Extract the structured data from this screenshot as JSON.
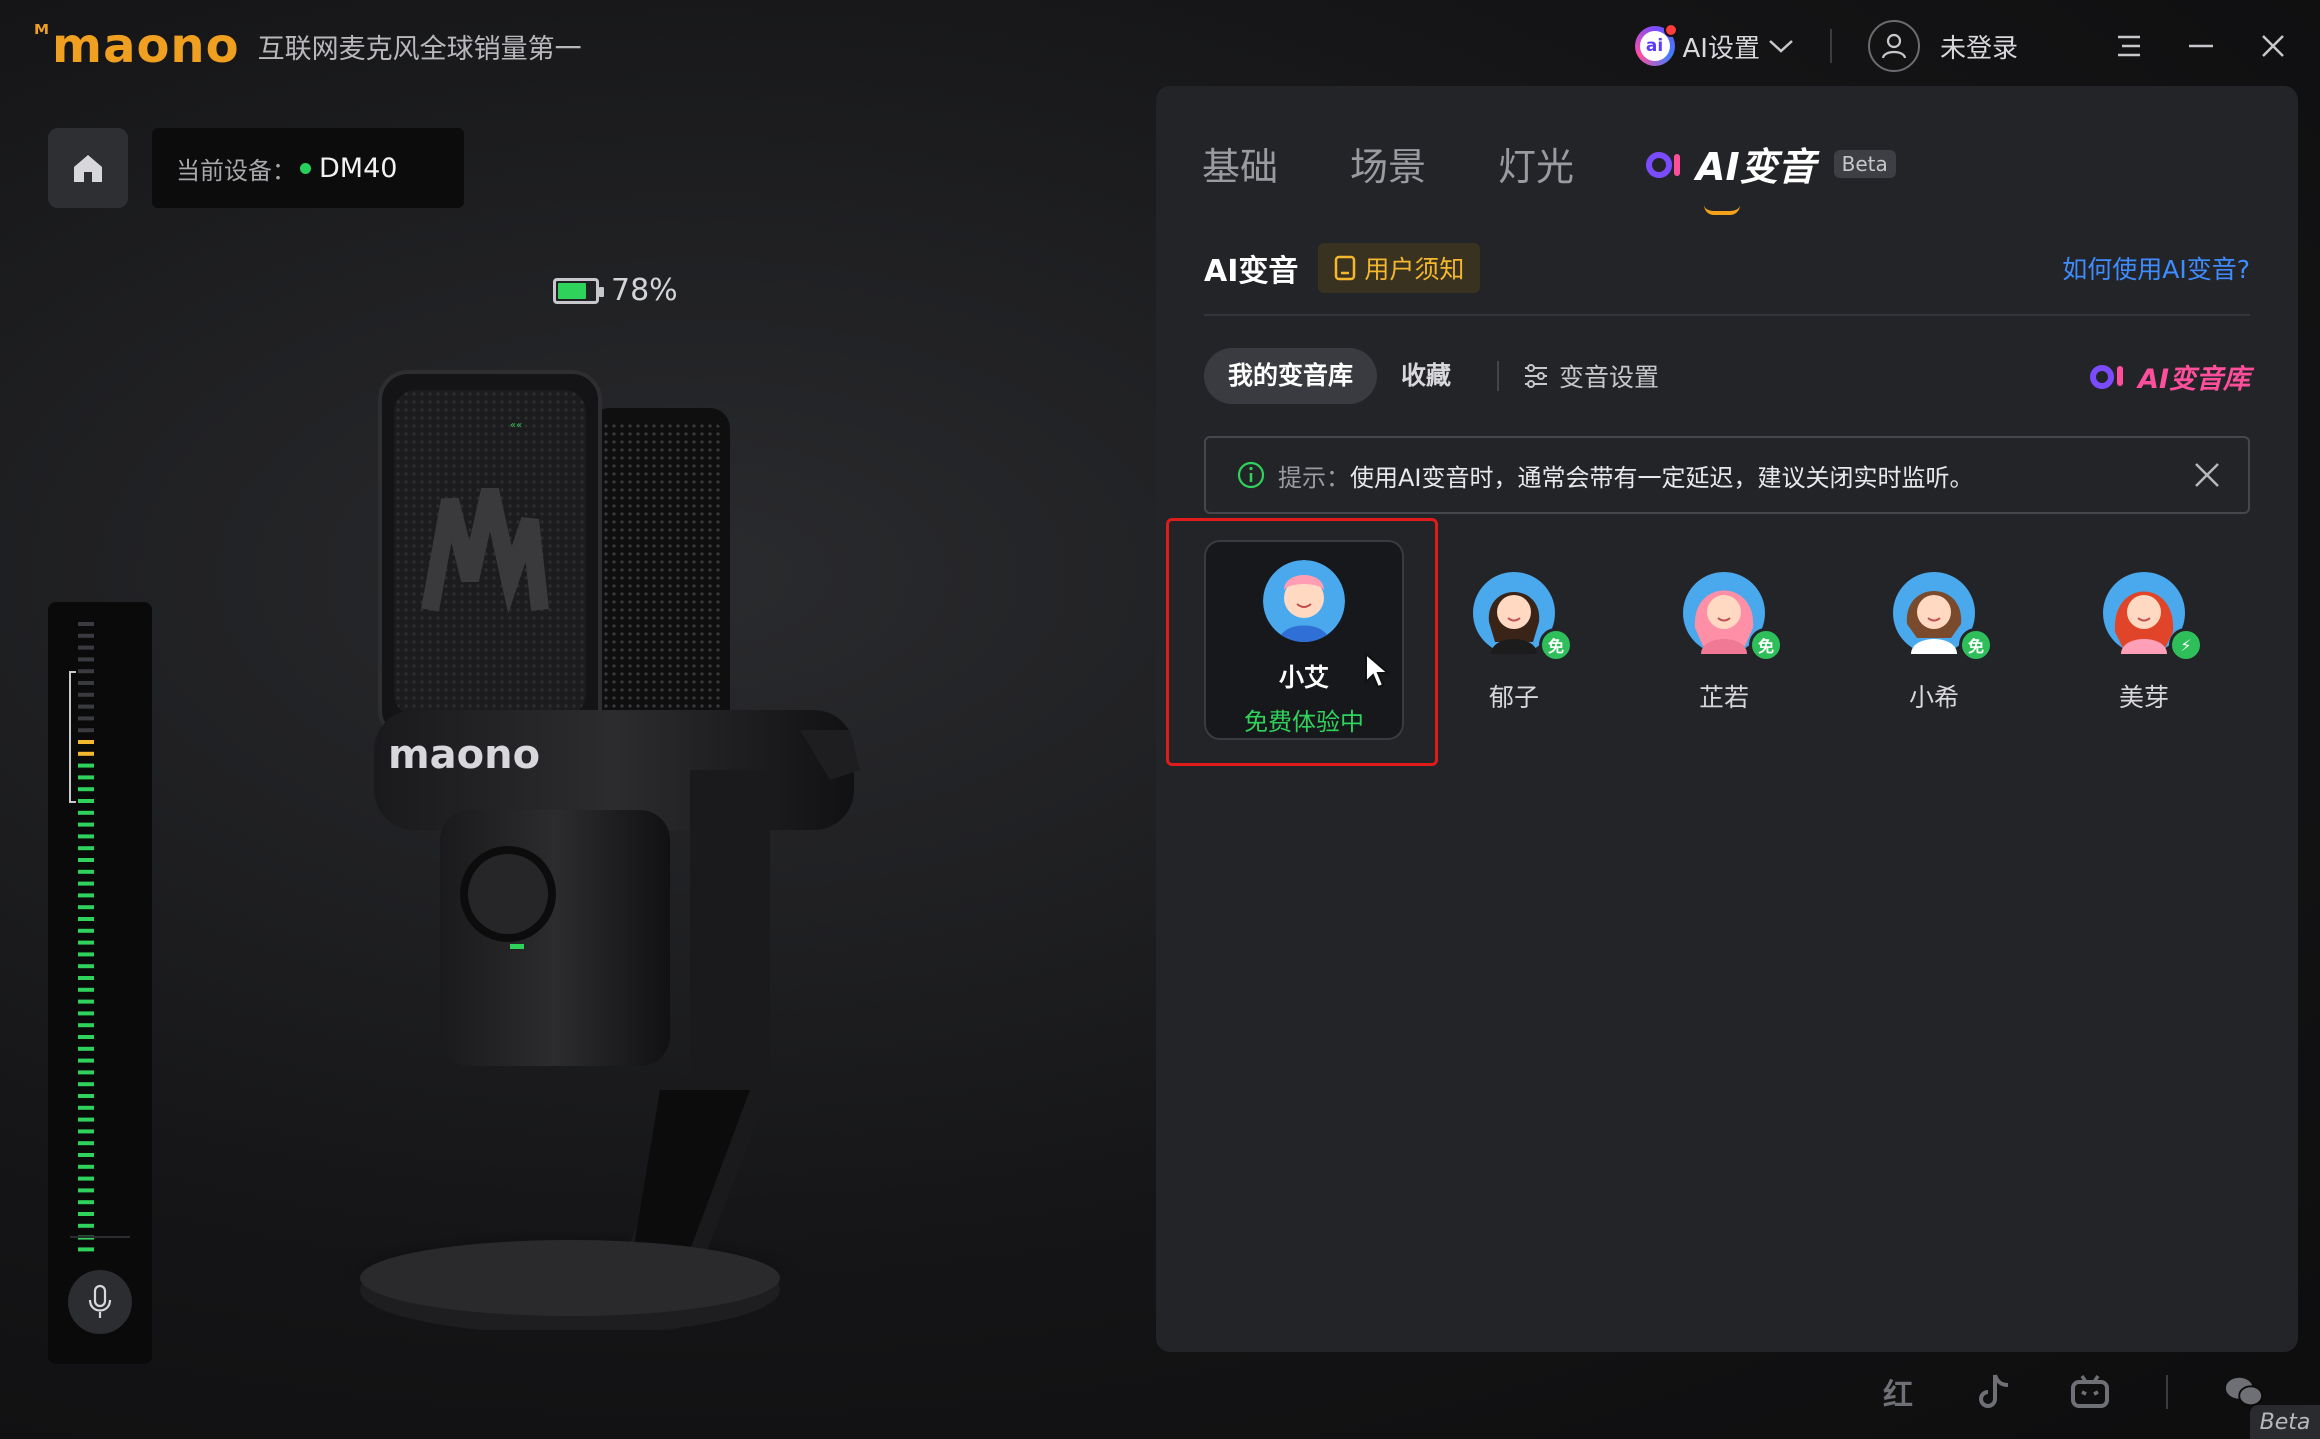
{
  "brand": {
    "logo": "maono",
    "slogan": "互联网麦克风全球销量第一"
  },
  "titlebar": {
    "ai_settings_label": "AI设置",
    "user_label": "未登录"
  },
  "device": {
    "label": "当前设备：",
    "name": "DM40"
  },
  "battery": {
    "percent_text": "78%",
    "level": 0.78
  },
  "meter": {
    "level": 0.82
  },
  "panel": {
    "tabs": [
      {
        "label": "基础"
      },
      {
        "label": "场景"
      },
      {
        "label": "灯光"
      }
    ],
    "ai_tab": {
      "label": "AI变音",
      "badge": "Beta"
    },
    "section_title": "AI变音",
    "notice_button": "用户须知",
    "howto_link": "如何使用AI变音?",
    "subtabs": [
      {
        "label": "我的变音库",
        "active": true
      },
      {
        "label": "收藏",
        "active": false
      }
    ],
    "voice_settings": "变音设置",
    "ai_library": "AI变音库",
    "tip": {
      "prefix": "提示：",
      "message": "使用AI变音时，通常会带有一定延迟，建议关闭实时监听。"
    },
    "voices": [
      {
        "name": "小艾",
        "status": "免费体验中",
        "selected": true,
        "badge": ""
      },
      {
        "name": "郁子",
        "badge": "免"
      },
      {
        "name": "芷若",
        "badge": "免"
      },
      {
        "name": "小希",
        "badge": "免"
      },
      {
        "name": "美芽",
        "badge": "⚡"
      }
    ]
  },
  "footer": {
    "beta_label": "Beta",
    "social_icons": [
      "xiaohongshu-icon",
      "tiktok-icon",
      "bilibili-icon",
      "wechat-icon"
    ]
  },
  "colors": {
    "accent_orange": "#f0a020",
    "green": "#2fd35b",
    "link_blue": "#3f8cff",
    "ai_pink": "#ff4f9c",
    "highlight_red": "#e01b1b"
  }
}
